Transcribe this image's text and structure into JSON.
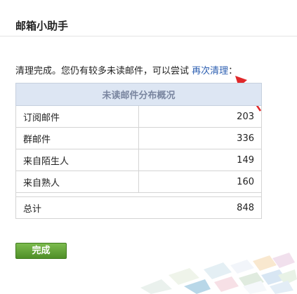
{
  "dialog": {
    "title": "邮箱小助手"
  },
  "message": {
    "prefix": "清理完成。您仍有较多未读邮件，可以尝试 ",
    "link": "再次清理",
    "suffix": "："
  },
  "table": {
    "header": "未读邮件分布概况",
    "rows": [
      {
        "label": "订阅邮件",
        "value": "203"
      },
      {
        "label": "群邮件",
        "value": "336"
      },
      {
        "label": "来自陌生人",
        "value": "149"
      },
      {
        "label": "来自熟人",
        "value": "160"
      }
    ],
    "total": {
      "label": "总计",
      "value": "848"
    }
  },
  "actions": {
    "done_label": "完成",
    "done_color": "#5a9a32"
  },
  "annotation": {
    "arrow_color": "#e0282a"
  }
}
